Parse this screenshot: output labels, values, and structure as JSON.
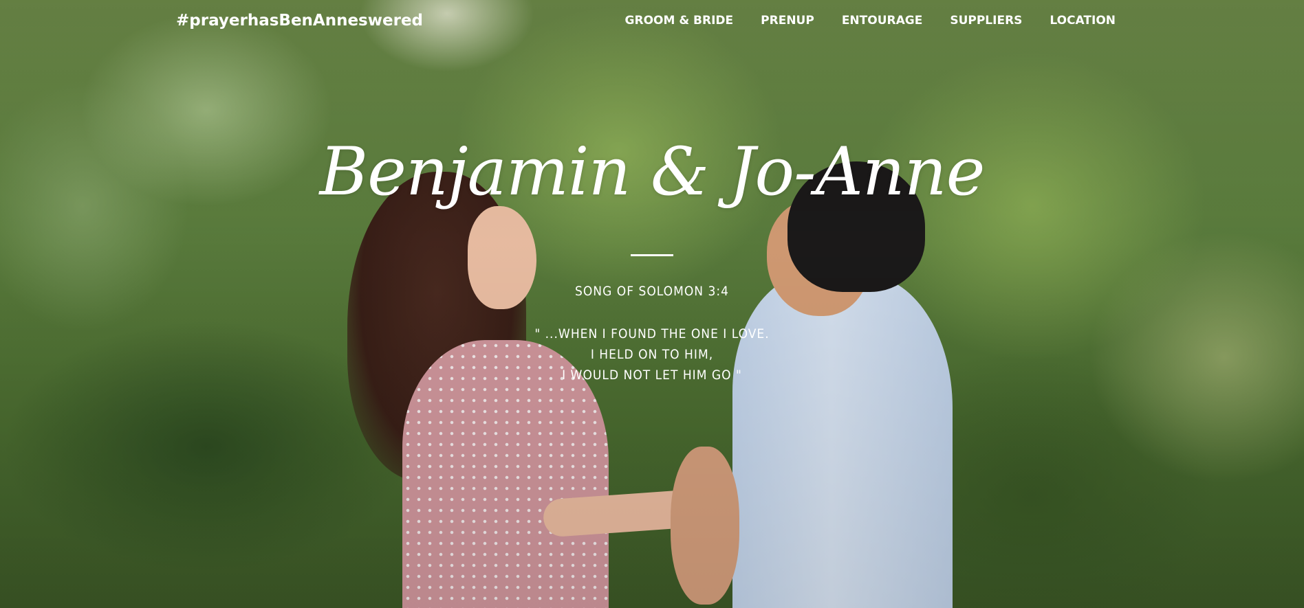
{
  "nav": {
    "brand": "#prayerhasBenAnneswered",
    "items": [
      {
        "label": "GROOM & BRIDE"
      },
      {
        "label": "PRENUP"
      },
      {
        "label": "ENTOURAGE"
      },
      {
        "label": "SUPPLIERS"
      },
      {
        "label": "LOCATION"
      }
    ]
  },
  "hero": {
    "names": "Benjamin & Jo-Anne",
    "verse_reference": "SONG OF SOLOMON 3:4",
    "verse_lines": [
      "\" ...WHEN I FOUND THE ONE I LOVE.",
      "I HELD ON TO HIM,",
      "I WOULD NOT LET HIM GO \""
    ]
  },
  "colors": {
    "text": "#ffffff",
    "foliage": "#5f8240",
    "dress": "#d59aa0",
    "shirt": "#dce8f7"
  }
}
